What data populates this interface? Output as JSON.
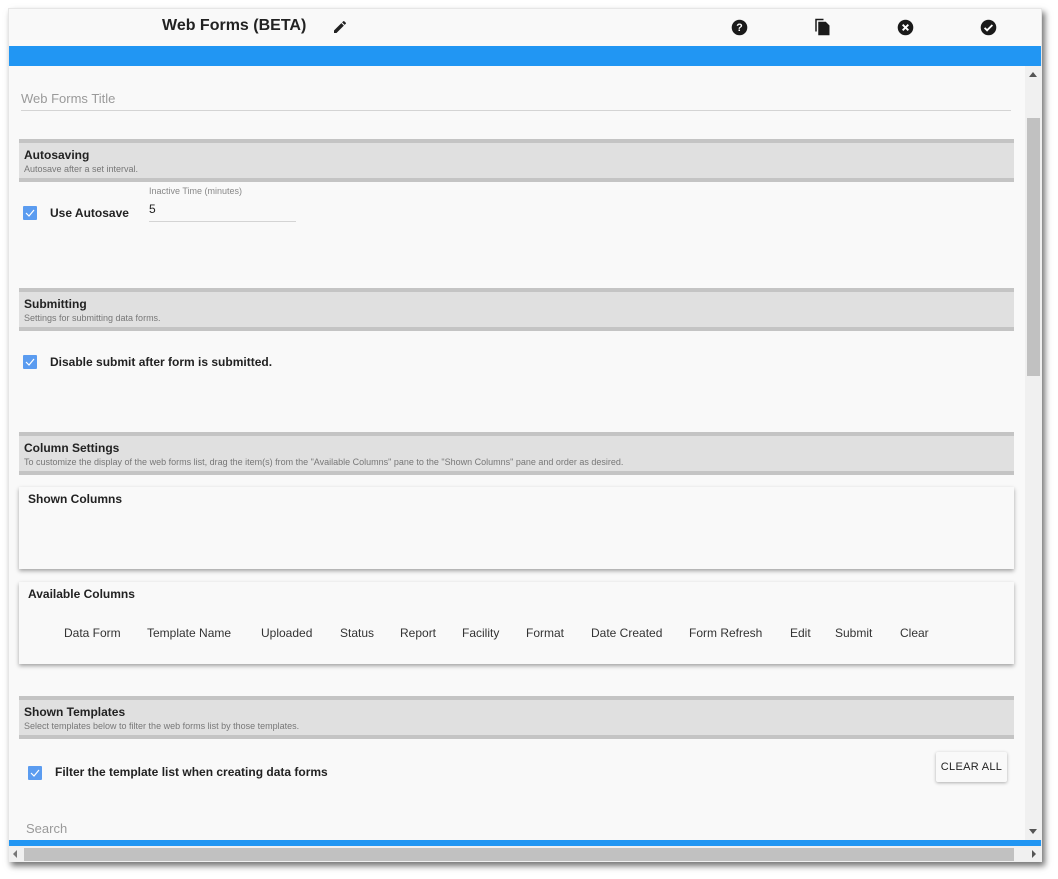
{
  "window": {
    "title": "Web Forms (BETA)",
    "toolbar_icons": [
      "pencil-icon",
      "help-icon",
      "copy-icon",
      "cancel-icon",
      "confirm-icon"
    ],
    "accent_color": "#2196f3"
  },
  "title_field": {
    "placeholder": "Web Forms Title",
    "value": ""
  },
  "autosaving": {
    "heading": "Autosaving",
    "description": "Autosave after a set interval.",
    "use_autosave_label": "Use Autosave",
    "use_autosave_checked": true,
    "inactive_time_label": "Inactive Time (minutes)",
    "inactive_time_value": "5"
  },
  "submitting": {
    "heading": "Submitting",
    "description": "Settings for submitting data forms.",
    "disable_submit_label": "Disable submit after form is submitted.",
    "disable_submit_checked": true
  },
  "column_settings": {
    "heading": "Column Settings",
    "description": "To customize the display of the web forms list, drag the item(s) from the \"Available Columns\" pane to the \"Shown Columns\" pane and order as desired.",
    "shown_columns_title": "Shown Columns",
    "shown_columns": [],
    "available_columns_title": "Available Columns",
    "available_columns": [
      "Data Form",
      "Template Name",
      "Uploaded",
      "Status",
      "Report",
      "Facility",
      "Format",
      "Date Created",
      "Form Refresh",
      "Edit",
      "Submit",
      "Clear"
    ]
  },
  "shown_templates": {
    "heading": "Shown Templates",
    "description": "Select templates below to filter the web forms list by those templates.",
    "filter_label": "Filter the template list when creating data forms",
    "filter_checked": true,
    "clear_all_label": "CLEAR ALL",
    "search_placeholder": "Search"
  }
}
